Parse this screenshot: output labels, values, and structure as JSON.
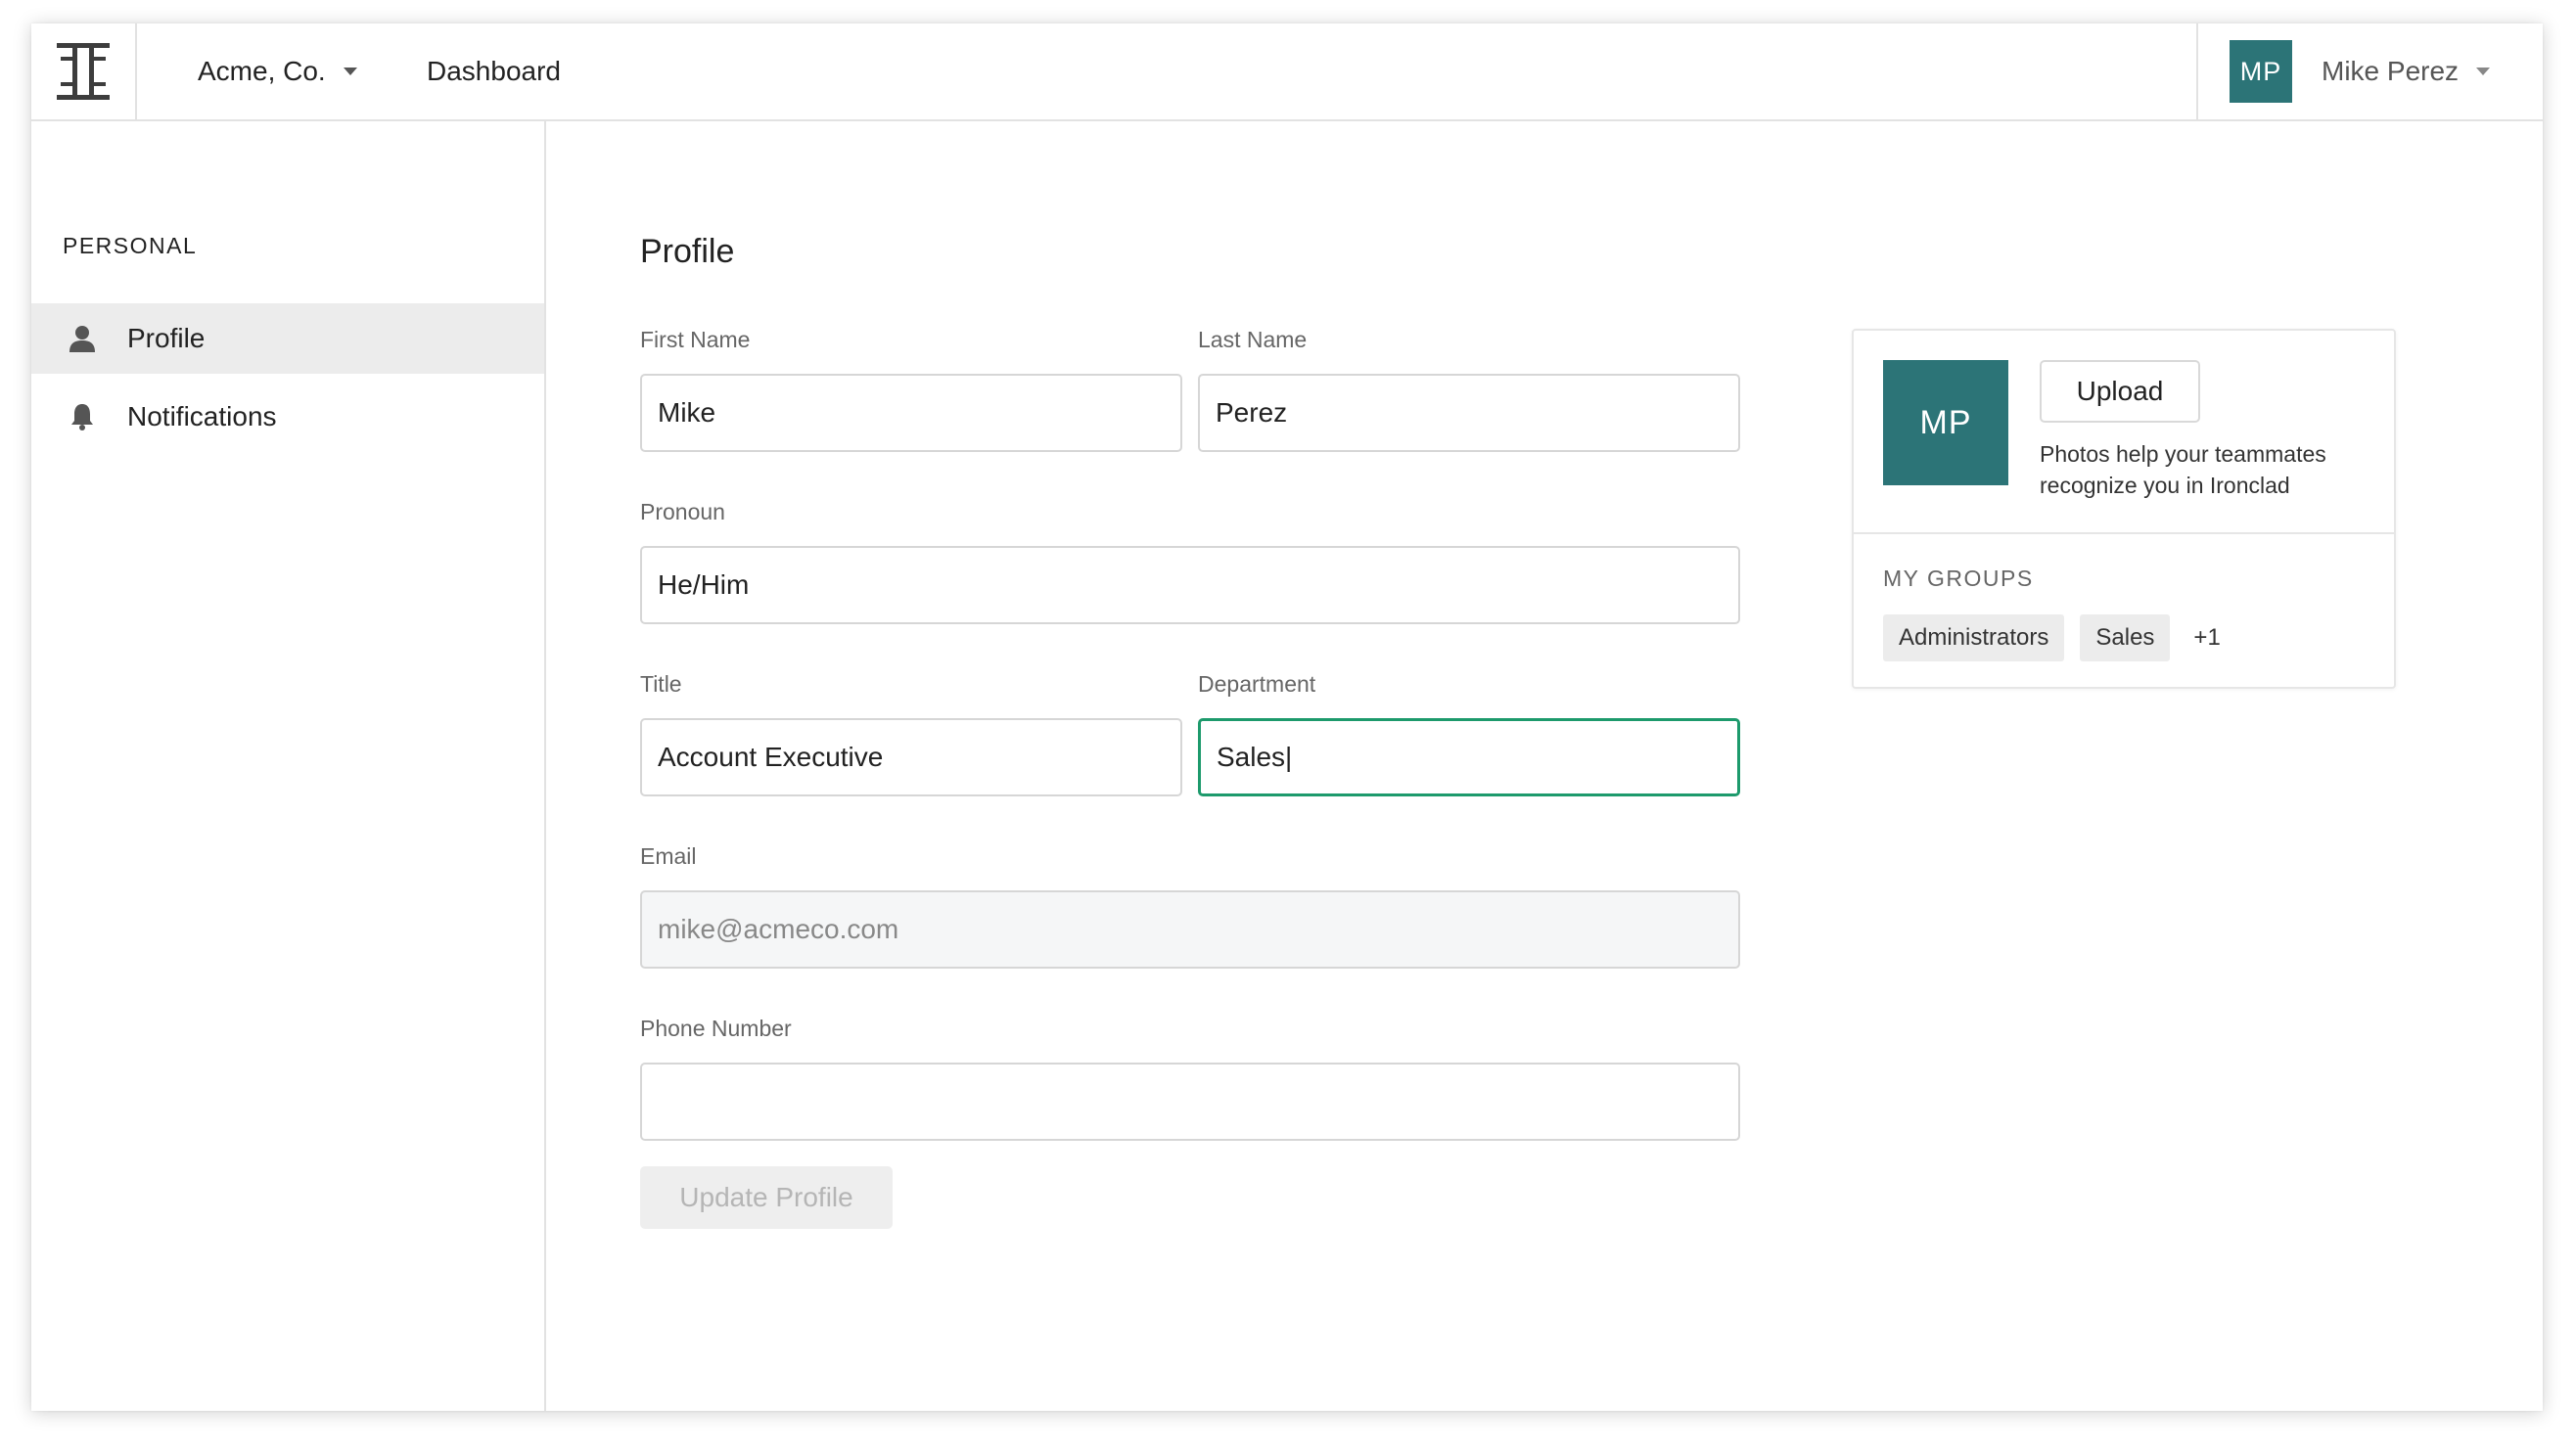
{
  "header": {
    "logo_icon": "ironclad-logo-icon",
    "company": "Acme, Co.",
    "nav_dashboard": "Dashboard",
    "user_initials": "MP",
    "user_name": "Mike Perez"
  },
  "sidebar": {
    "heading": "PERSONAL",
    "items": [
      {
        "label": "Profile",
        "icon": "person-icon",
        "active": true
      },
      {
        "label": "Notifications",
        "icon": "bell-icon",
        "active": false
      }
    ]
  },
  "form": {
    "title": "Profile",
    "first_name": {
      "label": "First Name",
      "value": "Mike"
    },
    "last_name": {
      "label": "Last Name",
      "value": "Perez"
    },
    "pronoun": {
      "label": "Pronoun",
      "value": "He/Him"
    },
    "title_field": {
      "label": "Title",
      "value": "Account Executive"
    },
    "department": {
      "label": "Department",
      "value": "Sales|"
    },
    "email": {
      "label": "Email",
      "value": "mike@acmeco.com"
    },
    "phone": {
      "label": "Phone Number",
      "value": ""
    },
    "submit_label": "Update Profile"
  },
  "photo_card": {
    "initials": "MP",
    "upload_label": "Upload",
    "help_text": "Photos help your teammates recognize you in Ironclad",
    "groups_heading": "MY GROUPS",
    "groups": [
      "Administrators",
      "Sales"
    ],
    "more_count": "+1"
  },
  "colors": {
    "avatar_bg": "#2c7477",
    "focus_border": "#1d9a6c"
  }
}
